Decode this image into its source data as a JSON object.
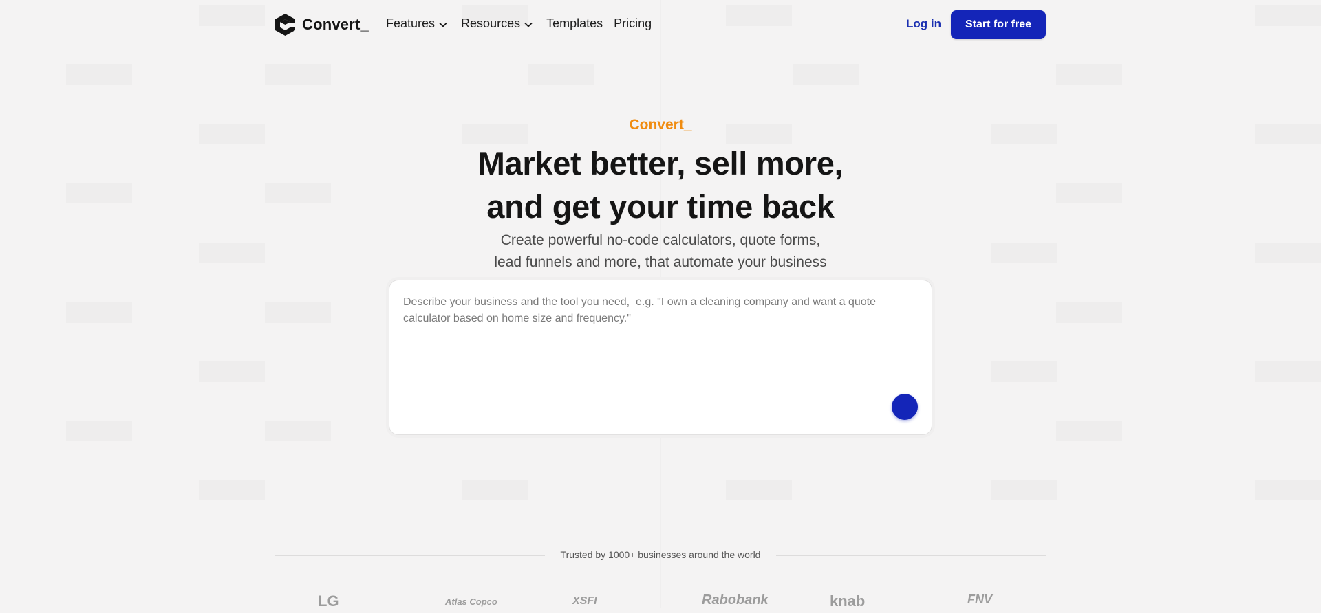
{
  "nav": {
    "logo_text": "Convert_",
    "links": [
      {
        "label": "Features",
        "has_dropdown": true
      },
      {
        "label": "Resources",
        "has_dropdown": true
      },
      {
        "label": "Templates",
        "has_dropdown": false
      },
      {
        "label": "Pricing",
        "has_dropdown": false
      }
    ],
    "login_label": "Log in",
    "cta_label": "Start for free"
  },
  "hero": {
    "eyebrow": "Convert_",
    "headline_line1": "Market better, sell more,",
    "headline_line2": "and get your time back",
    "subhead_line1": "Create powerful no-code calculators, quote forms,",
    "subhead_line2": "lead funnels and more, that automate your business"
  },
  "prompt": {
    "placeholder": "Describe your business and the tool you need,  e.g. \"I own a cleaning company and want a quote calculator based on home size and frequency.\"",
    "value": ""
  },
  "trust": {
    "text": "Trusted by 1000+ businesses around the world",
    "brands": [
      "LG",
      "Atlas Copco",
      "XSFI",
      "Rabobank",
      "knab",
      "FNV"
    ]
  },
  "colors": {
    "accent": "#1425b8",
    "eyebrow": "#f08c10",
    "background": "#f4f3f3"
  }
}
